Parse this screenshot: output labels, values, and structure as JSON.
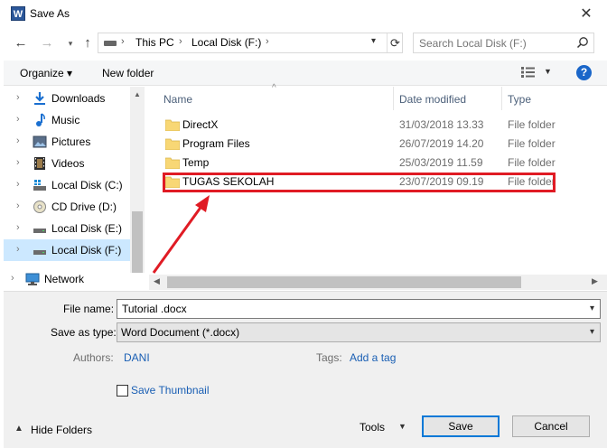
{
  "window": {
    "title": "Save As",
    "app_icon_letter": "W",
    "close_glyph": "✕"
  },
  "address": {
    "crumbs": [
      "This PC",
      "Local Disk (F:)"
    ],
    "search_placeholder": "Search Local Disk (F:)"
  },
  "toolbar": {
    "organize_label": "Organize ▾",
    "new_folder_label": "New folder",
    "help_label": "?"
  },
  "navigation": {
    "items": [
      {
        "label": "Downloads",
        "icon": "download-arrow-icon"
      },
      {
        "label": "Music",
        "icon": "music-note-icon"
      },
      {
        "label": "Pictures",
        "icon": "pictures-icon"
      },
      {
        "label": "Videos",
        "icon": "film-strip-icon"
      },
      {
        "label": "Local Disk (C:)",
        "icon": "drive-icon"
      },
      {
        "label": "CD Drive (D:)",
        "icon": "cd-drive-icon"
      },
      {
        "label": "Local Disk (E:)",
        "icon": "drive-icon"
      },
      {
        "label": "Local Disk (F:)",
        "icon": "drive-icon",
        "selected": true
      },
      {
        "label": "Network",
        "icon": "network-icon"
      }
    ]
  },
  "files": {
    "columns": [
      "Name",
      "Date modified",
      "Type"
    ],
    "rows": [
      {
        "name": "DirectX",
        "date": "31/03/2018 13.33",
        "type": "File folder"
      },
      {
        "name": "Program Files",
        "date": "26/07/2019 14.20",
        "type": "File folder"
      },
      {
        "name": "Temp",
        "date": "25/03/2019 11.59",
        "type": "File folder"
      },
      {
        "name": "TUGAS SEKOLAH",
        "date": "23/07/2019 09.19",
        "type": "File folder",
        "highlighted": true
      }
    ]
  },
  "form": {
    "file_name_label": "File name:",
    "file_name_value": "Tutorial .docx",
    "save_type_label": "Save as type:",
    "save_type_value": "Word Document (*.docx)",
    "authors_label": "Authors:",
    "authors_value": "DANI",
    "tags_label": "Tags:",
    "tags_value": "Add a tag",
    "save_thumbnail_label": "Save Thumbnail",
    "save_thumbnail_checked": false
  },
  "footer": {
    "hide_folders_label": "Hide Folders",
    "tools_label": "Tools",
    "save_label": "Save",
    "cancel_label": "Cancel"
  },
  "colors": {
    "highlight": "#e01b24",
    "link": "#1a5fb4",
    "selection": "#cce8ff",
    "folder": "#f8d775"
  }
}
